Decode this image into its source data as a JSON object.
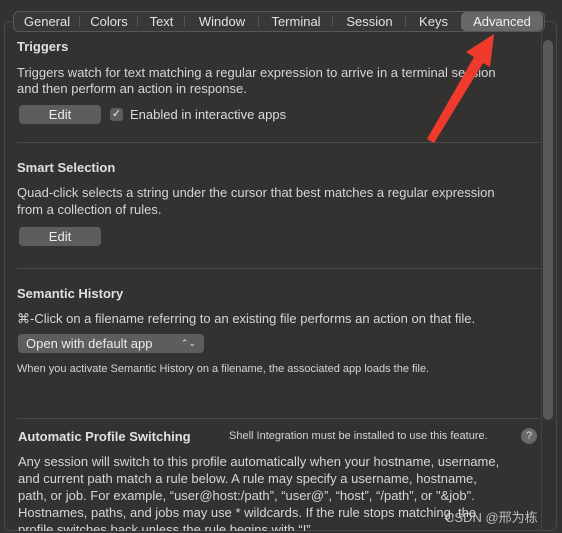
{
  "tabs": [
    "General",
    "Colors",
    "Text",
    "Window",
    "Terminal",
    "Session",
    "Keys",
    "Advanced"
  ],
  "active_tab": "Advanced",
  "triggers": {
    "title": "Triggers",
    "desc1": "Triggers watch for text matching a regular expression to arrive in a terminal session",
    "desc2": "and then perform an action in response.",
    "edit": "Edit",
    "checkbox_label": "Enabled in interactive apps",
    "checked": true
  },
  "smart": {
    "title": "Smart Selection",
    "desc1": "Quad-click selects a string under the cursor that best matches a regular expression",
    "desc2": "from a collection of rules.",
    "edit": "Edit"
  },
  "semantic": {
    "title": "Semantic History",
    "desc": "⌘-Click on a filename referring to an existing file performs an action on that file.",
    "popup": "Open with default app",
    "note": "When you activate Semantic History on a filename, the associated app loads the file."
  },
  "aps": {
    "title": "Automatic Profile Switching",
    "shell_note": "Shell Integration must be installed to use this feature.",
    "help": "?",
    "lines": [
      "Any session will switch to this profile automatically when your hostname, username,",
      "and current path match a rule below. A rule may specify a username, hostname,",
      "path, or job. For example, “user@host:/path”, “user@”, “host”, “/path”, or \"&job\".",
      "Hostnames, paths, and jobs may use * wildcards. If the rule stops matching, the",
      "profile switches back unless the rule begins with “!”"
    ]
  },
  "watermark": "CSDN @邢为栋",
  "colors": {
    "background": "#343231",
    "arrow": "#f03a2e",
    "active_tab": "#6a6867"
  }
}
